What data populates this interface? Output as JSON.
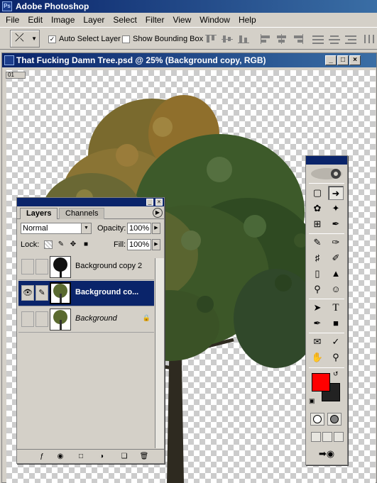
{
  "app": {
    "title": "Adobe Photoshop",
    "icon": "photoshop-icon"
  },
  "menu": [
    "File",
    "Edit",
    "Image",
    "Layer",
    "Select",
    "Filter",
    "View",
    "Window",
    "Help"
  ],
  "options": {
    "auto_select_label": "Auto Select Layer",
    "auto_select_checked": true,
    "show_bounding_label": "Show Bounding Box",
    "show_bounding_checked": false
  },
  "document": {
    "title": "That Fucking Damn Tree.psd @ 25% (Background copy, RGB)",
    "ruler_tag": "01",
    "image": "tree-photo"
  },
  "layers_palette": {
    "tabs": [
      "Layers",
      "Channels"
    ],
    "blend_mode": "Normal",
    "opacity_label": "Opacity:",
    "opacity": "100%",
    "lock_label": "Lock:",
    "fill_label": "Fill:",
    "fill": "100%",
    "layers": [
      {
        "name": "Background copy 2",
        "visible": false,
        "selected": false,
        "locked": false
      },
      {
        "name": "Background co...",
        "visible": true,
        "selected": true,
        "locked": false
      },
      {
        "name": "Background",
        "visible": false,
        "selected": false,
        "locked": true
      }
    ]
  },
  "toolbox": {
    "foreground_color": "#ff0000",
    "background_color": "#222222",
    "tools": [
      "marquee-icon",
      "move-icon",
      "lasso-icon",
      "magic-wand-icon",
      "crop-icon",
      "slice-icon",
      "healing-brush-icon",
      "brush-icon",
      "clone-stamp-icon",
      "history-brush-icon",
      "eraser-icon",
      "paint-bucket-icon",
      "dodge-icon",
      "smudge-icon",
      "path-select-icon",
      "type-icon",
      "pen-icon",
      "shape-icon",
      "notes-icon",
      "eyedropper-icon",
      "hand-icon",
      "zoom-icon"
    ],
    "type_tool_glyph": "T"
  }
}
